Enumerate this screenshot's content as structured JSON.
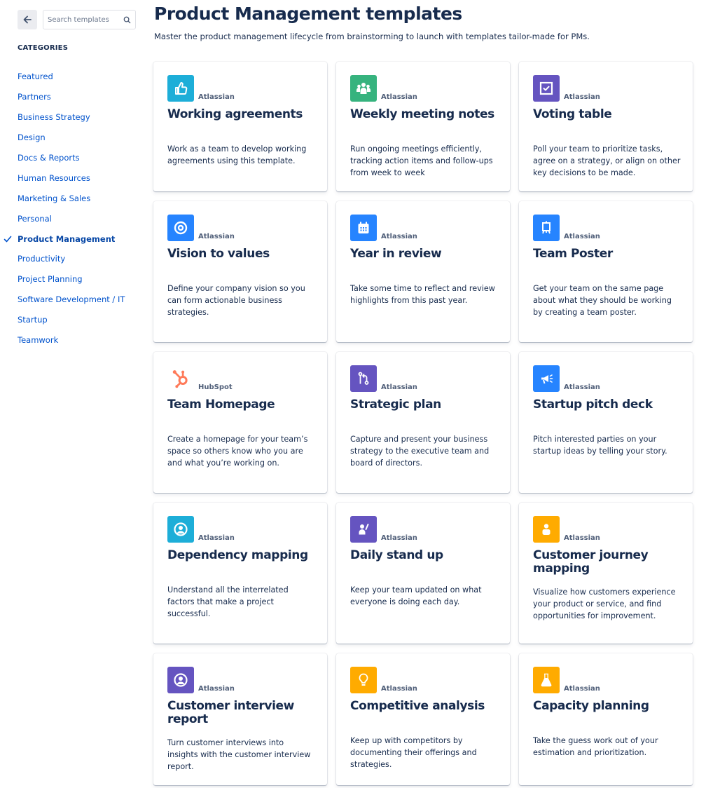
{
  "sidebar": {
    "back_label": "Back",
    "search": {
      "placeholder": "Search templates",
      "value": ""
    },
    "categories_heading": "CATEGORIES",
    "categories": [
      {
        "label": "Featured",
        "active": false
      },
      {
        "label": "Partners",
        "active": false
      },
      {
        "label": "Business Strategy",
        "active": false
      },
      {
        "label": "Design",
        "active": false
      },
      {
        "label": "Docs & Reports",
        "active": false
      },
      {
        "label": "Human Resources",
        "active": false
      },
      {
        "label": "Marketing & Sales",
        "active": false
      },
      {
        "label": "Personal",
        "active": false
      },
      {
        "label": "Product Management",
        "active": true
      },
      {
        "label": "Productivity",
        "active": false
      },
      {
        "label": "Project Planning",
        "active": false
      },
      {
        "label": "Software Development / IT",
        "active": false
      },
      {
        "label": "Startup",
        "active": false
      },
      {
        "label": "Teamwork",
        "active": false
      }
    ]
  },
  "header": {
    "title": "Product Management templates",
    "subtitle": "Master the product management lifecycle from brainstorming to launch with templates tailor-made for PMs."
  },
  "colors": {
    "teal": "#1DAED8",
    "green": "#36B37E",
    "purple": "#6554C0",
    "blue": "#2684FF",
    "orange": "#FFAB00",
    "hubspot": "#FF7A59",
    "link": "#0052CC"
  },
  "templates": [
    {
      "title": "Working agreements",
      "vendor": "Atlassian",
      "icon": "thumbs-up-icon",
      "color": "#1DAED8",
      "description": "Work as a team to develop working agreements using this template."
    },
    {
      "title": "Weekly meeting notes",
      "vendor": "Atlassian",
      "icon": "team-icon",
      "color": "#36B37E",
      "description": "Run ongoing meetings efficiently, tracking action items and follow-ups from week to week"
    },
    {
      "title": "Voting table",
      "vendor": "Atlassian",
      "icon": "checkbox-icon",
      "color": "#6554C0",
      "description": "Poll your team to prioritize tasks, agree on a strategy, or align on other key decisions to be made."
    },
    {
      "title": "Vision to values",
      "vendor": "Atlassian",
      "icon": "eye-icon",
      "color": "#2684FF",
      "description": "Define your company vision so you can form actionable business strategies."
    },
    {
      "title": "Year in review",
      "vendor": "Atlassian",
      "icon": "calendar-icon",
      "color": "#2684FF",
      "description": "Take some time to reflect and review highlights from this past year."
    },
    {
      "title": "Team Poster",
      "vendor": "Atlassian",
      "icon": "easel-icon",
      "color": "#2684FF",
      "description": "Get your team on the same page about what they should be working by creating a team poster."
    },
    {
      "title": "Team Homepage",
      "vendor": "HubSpot",
      "icon": "hubspot-icon",
      "color": "#FF7A59",
      "description": "Create a homepage for your team’s space so others know who you are and what you’re working on."
    },
    {
      "title": "Strategic plan",
      "vendor": "Atlassian",
      "icon": "branch-icon",
      "color": "#6554C0",
      "description": "Capture and present your business strategy to the executive team and board of directors."
    },
    {
      "title": "Startup pitch deck",
      "vendor": "Atlassian",
      "icon": "megaphone-icon",
      "color": "#2684FF",
      "description": "Pitch interested parties on your startup ideas by telling your story."
    },
    {
      "title": "Dependency mapping",
      "vendor": "Atlassian",
      "icon": "person-circle-icon",
      "color": "#1DAED8",
      "description": "Understand all the interrelated factors that make a project successful."
    },
    {
      "title": "Daily stand up",
      "vendor": "Atlassian",
      "icon": "person-wave-icon",
      "color": "#6554C0",
      "description": "Keep your team updated on what everyone is doing each day."
    },
    {
      "title": "Customer journey mapping",
      "vendor": "Atlassian",
      "icon": "person-icon",
      "color": "#FFAB00",
      "description": "Visualize how customers experience your product or service, and find opportunities for improvement."
    },
    {
      "title": "Customer interview report",
      "vendor": "Atlassian",
      "icon": "person-circle-icon",
      "color": "#6554C0",
      "description": "Turn customer interviews into insights with the customer interview report."
    },
    {
      "title": "Competitive analysis",
      "vendor": "Atlassian",
      "icon": "lightbulb-icon",
      "color": "#FFAB00",
      "description": "Keep up with competitors by documenting their offerings and strategies."
    },
    {
      "title": "Capacity planning",
      "vendor": "Atlassian",
      "icon": "flask-icon",
      "color": "#FFAB00",
      "description": "Take the guess work out of your estimation and prioritization."
    }
  ]
}
